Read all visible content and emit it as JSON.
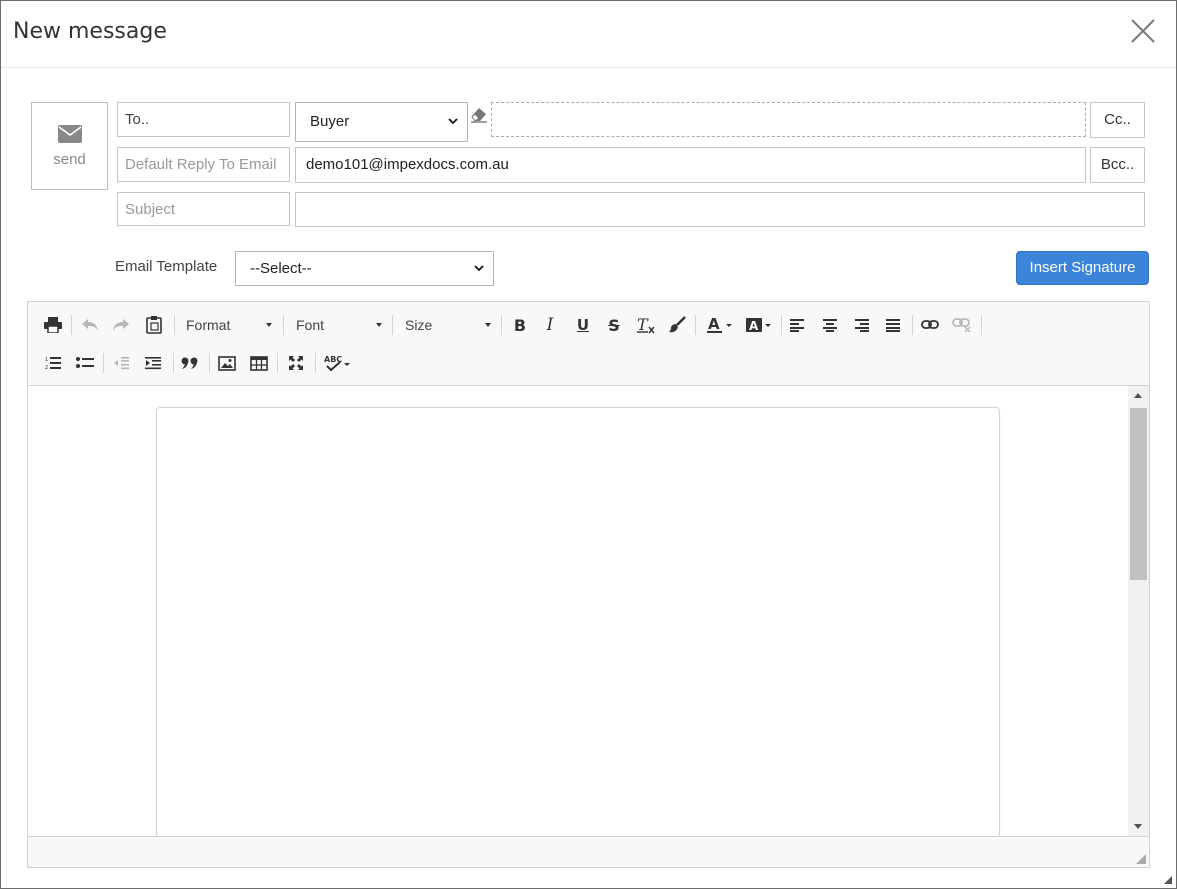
{
  "dialog": {
    "title": "New message",
    "close_icon": "close-icon"
  },
  "send": {
    "icon": "envelope-icon",
    "label": "send"
  },
  "compose": {
    "to_label": "To..",
    "recipient_type": "Buyer",
    "to_value": "",
    "cc_label": "Cc..",
    "reply_to_placeholder": "Default Reply To Email",
    "reply_to_value": "demo101@impexdocs.com.au",
    "bcc_label": "Bcc..",
    "subject_placeholder": "Subject",
    "subject_value": ""
  },
  "template": {
    "label": "Email Template",
    "selected": "--Select--"
  },
  "insert_signature_label": "Insert Signature",
  "toolbar": {
    "format_label": "Format",
    "font_label": "Font",
    "size_label": "Size"
  },
  "colors": {
    "primary_button": "#3b84d9",
    "toolbar_bg": "#f8f8f8"
  }
}
